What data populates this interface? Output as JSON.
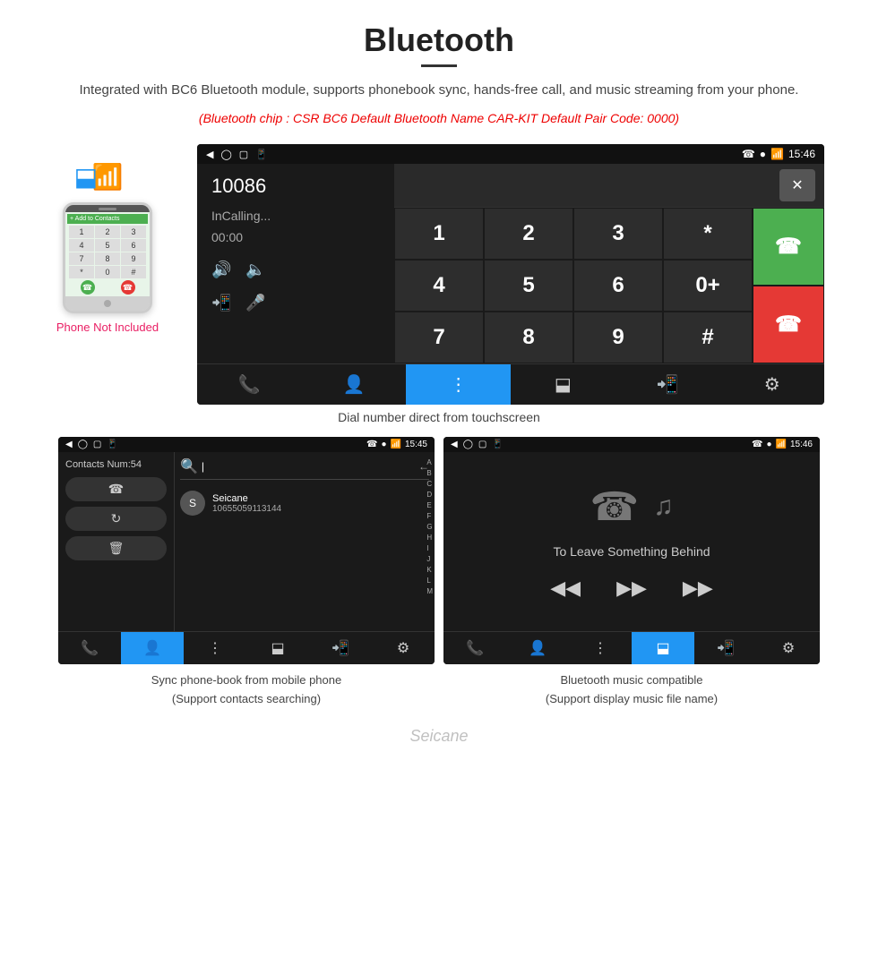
{
  "header": {
    "title": "Bluetooth",
    "description": "Integrated with BC6 Bluetooth module, supports phonebook sync, hands-free call, and music streaming from your phone.",
    "specs": "(Bluetooth chip : CSR BC6    Default Bluetooth Name CAR-KIT    Default Pair Code: 0000)"
  },
  "main_screen": {
    "status_bar": {
      "time": "15:46",
      "icons": "phone location wifi signal"
    },
    "dial": {
      "number": "10086",
      "status": "InCalling...",
      "timer": "00:00"
    },
    "keypad": {
      "keys": [
        "1",
        "2",
        "3",
        "*",
        "4",
        "5",
        "6",
        "0+",
        "7",
        "8",
        "9",
        "#"
      ]
    },
    "caption": "Dial number direct from touchscreen"
  },
  "contacts_screen": {
    "contacts_num": "Contacts Num:54",
    "contact_name": "Seicane",
    "contact_number": "10655059113144",
    "alpha_list": [
      "A",
      "B",
      "C",
      "D",
      "E",
      "F",
      "G",
      "H",
      "I",
      "J",
      "K",
      "L",
      "M"
    ]
  },
  "music_screen": {
    "song_title": "To Leave Something Behind",
    "time": "15:46"
  },
  "bottom_captions": {
    "left": "Sync phone-book from mobile phone\n(Support contacts searching)",
    "right": "Bluetooth music compatible\n(Support display music file name)"
  },
  "phone_not_included": "Phone Not Included",
  "watermark": "Seicane"
}
